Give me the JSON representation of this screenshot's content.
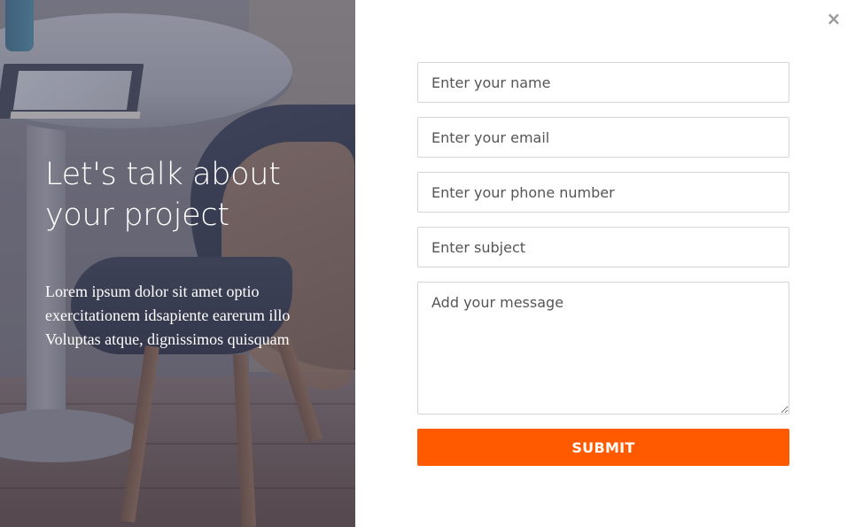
{
  "hero": {
    "headline": "Let's talk about your project",
    "blurb": "Lorem ipsum dolor sit amet optio exercitationem idsapiente earerum illo Voluptas atque, dignissimos quisquam"
  },
  "close": {
    "icon": "close-icon",
    "glyph": "×"
  },
  "form": {
    "name_placeholder": "Enter your name",
    "email_placeholder": "Enter your email",
    "phone_placeholder": "Enter your phone number",
    "subject_placeholder": "Enter subject",
    "message_placeholder": "Add your message",
    "submit_label": "SUBMIT"
  },
  "colors": {
    "accent": "#ff5a00",
    "field_border": "#d5d5d5",
    "close_icon": "#9a9a9a"
  }
}
